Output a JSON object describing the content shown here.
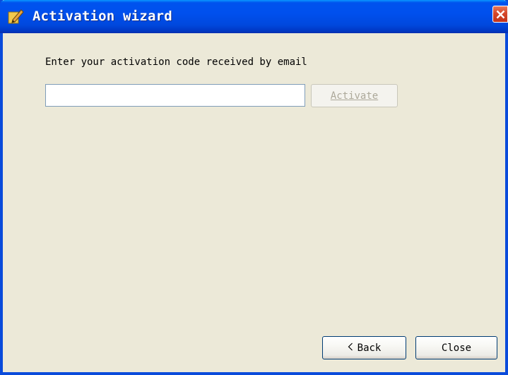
{
  "window": {
    "title": "Activation wizard"
  },
  "content": {
    "prompt": "Enter your activation code received by email",
    "code_value": "",
    "activate_label": "Activate"
  },
  "footer": {
    "back_label": "Back",
    "close_label": "Close"
  },
  "icons": {
    "app": "pencil-icon",
    "title_close": "close-icon",
    "back_chevron": "chevron-left-icon"
  },
  "colors": {
    "titlebar": "#0050EE",
    "window_bg": "#ECE9D8",
    "close_button": "#D4462A",
    "disabled_text": "#ACA899"
  }
}
